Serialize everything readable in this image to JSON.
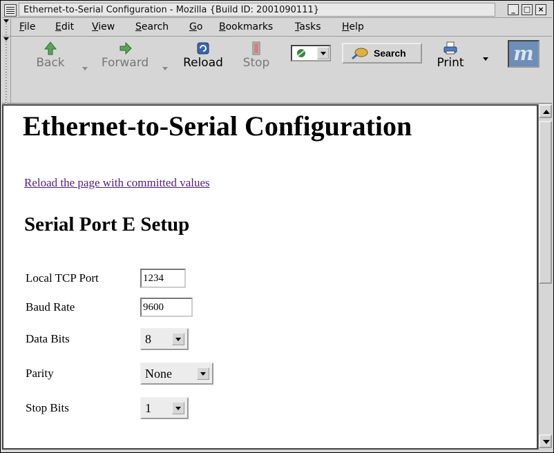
{
  "window": {
    "title": "Ethernet-to-Serial Configuration - Mozilla {Build ID: 2001090111}"
  },
  "menubar": {
    "items": [
      {
        "key": "F",
        "rest": "ile"
      },
      {
        "key": "E",
        "rest": "dit"
      },
      {
        "key": "V",
        "rest": "iew"
      },
      {
        "key": "S",
        "rest": "earch"
      },
      {
        "key": "G",
        "rest": "o"
      },
      {
        "key": "B",
        "rest": "ookmarks"
      },
      {
        "key": "T",
        "rest": "asks"
      },
      {
        "key": "H",
        "rest": "elp"
      }
    ]
  },
  "toolbar": {
    "back_label": "Back",
    "forward_label": "Forward",
    "reload_label": "Reload",
    "stop_label": "Stop",
    "search_label": "Search",
    "print_label": "Print",
    "icons": [
      "back-arrow-icon",
      "forward-arrow-icon",
      "reload-icon",
      "stop-icon",
      "search-engine-icon",
      "search-icon",
      "printer-icon",
      "mozilla-logo"
    ]
  },
  "page": {
    "heading": "Ethernet-to-Serial Configuration",
    "reload_link": "Reload the page with committed values",
    "section_heading": "Serial Port E Setup",
    "fields": {
      "tcp_port": {
        "label": "Local TCP Port",
        "value": "1234"
      },
      "baud_rate": {
        "label": "Baud Rate",
        "value": "9600"
      },
      "data_bits": {
        "label": "Data Bits",
        "value": "8"
      },
      "parity": {
        "label": "Parity",
        "value": "None"
      },
      "stop_bits": {
        "label": "Stop Bits",
        "value": "1"
      }
    }
  },
  "colors": {
    "link": "#551a8b",
    "chrome": "#d6d6d6",
    "logo": "#6c8eb8"
  }
}
